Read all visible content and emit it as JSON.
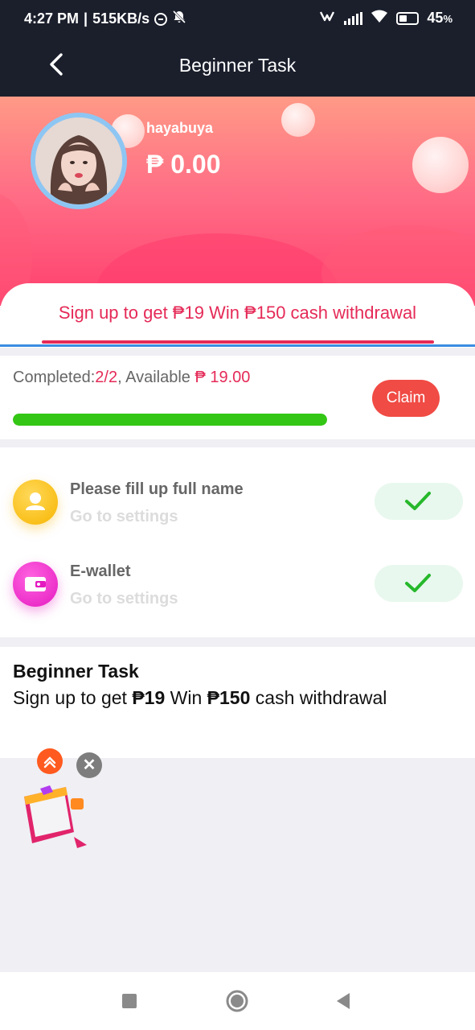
{
  "status_bar": {
    "time": "4:27 PM",
    "network_speed": "515KB/s",
    "battery": "45"
  },
  "header": {
    "title": "Beginner Task"
  },
  "profile": {
    "username": "hayabuya",
    "balance": "₱ 0.00"
  },
  "promo": {
    "text": "Sign up to get ₱19 Win ₱150 cash withdrawal"
  },
  "progress": {
    "completed_label": "Completed:",
    "completed_value": "2/2",
    "available_label": ", Available ",
    "available_value": "₱ 19.00",
    "claim_label": "Claim",
    "fraction": 1.0
  },
  "tasks": [
    {
      "title": "Please fill up full name",
      "subtitle": "Go to settings",
      "icon": "person-icon",
      "status": "completed"
    },
    {
      "title": "E-wallet",
      "subtitle": "Go to settings",
      "icon": "wallet-icon",
      "status": "completed"
    }
  ],
  "info": {
    "title": "Beginner Task",
    "text_prefix": "Sign up to get ",
    "amount_1": "₱19",
    "text_mid": " Win ",
    "amount_2": "₱150",
    "text_suffix": " cash withdrawal"
  },
  "colors": {
    "accent": "#e52a57",
    "success": "#33c614",
    "claim": "#f04b44",
    "header_bg": "#1b1f2c"
  }
}
